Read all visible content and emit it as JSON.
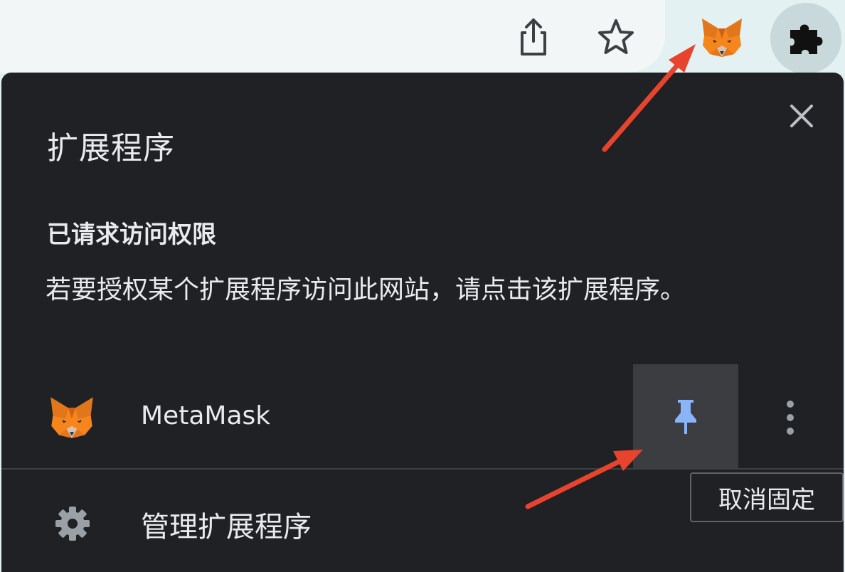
{
  "toolbar": {
    "share_icon": "share-icon",
    "star_icon": "star-icon",
    "extension_icon": "metamask-fox-icon",
    "extensions_menu_icon": "puzzle-icon"
  },
  "popup": {
    "title": "扩展程序",
    "close_icon": "close-icon",
    "section_title": "已请求访问权限",
    "section_description": "若要授权某个扩展程序访问此网站，请点击该扩展程序。",
    "extension": {
      "name": "MetaMask",
      "pin_icon": "pin-icon",
      "more_icon": "more-vert-icon"
    },
    "manage": {
      "label": "管理扩展程序",
      "icon": "gear-icon"
    },
    "tooltip": "取消固定"
  },
  "colors": {
    "popup_bg": "#202124",
    "text": "#e8eaed",
    "pin_blue": "#8ab4f8",
    "annotation_red": "#e8432d",
    "fox_orange": "#e2761b"
  }
}
